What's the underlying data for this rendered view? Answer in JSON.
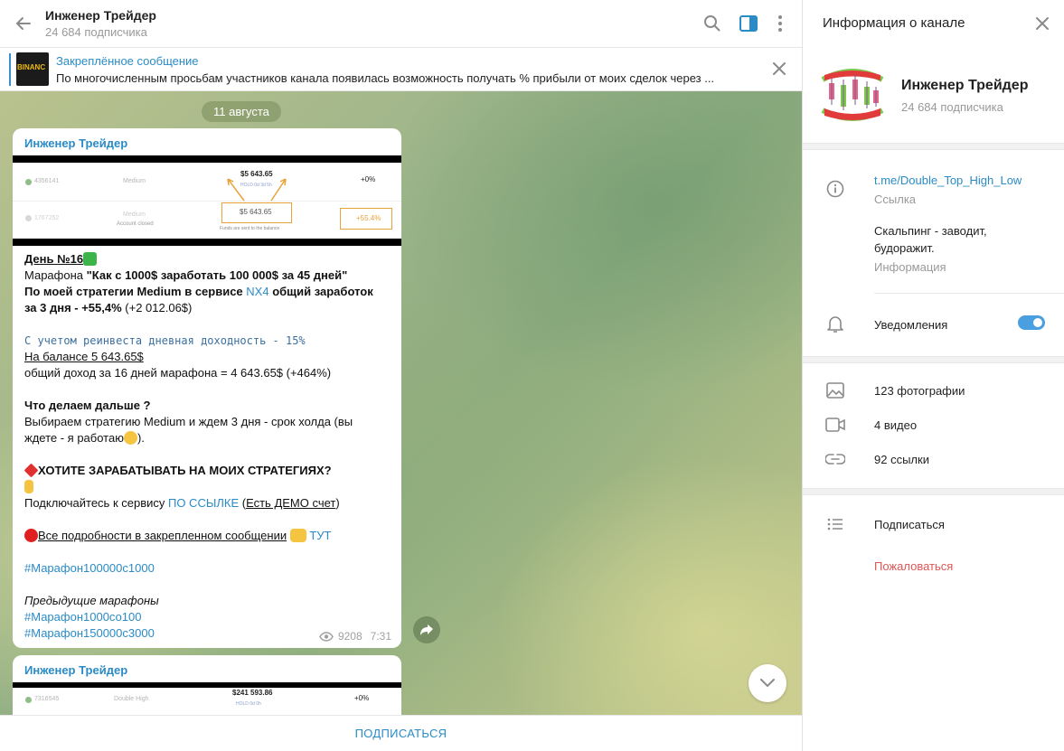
{
  "header": {
    "title": "Инженер Трейдер",
    "subscribers": "24 684 подписчика"
  },
  "pinned": {
    "title": "Закреплённое сообщение",
    "text": "По многочисленным просьбам участников канала появилась возможность получать % прибыли от моих сделок через ...",
    "thumb_label": "BINANC"
  },
  "chat": {
    "date": "11 августа",
    "message1": {
      "author": "Инженер Трейдер",
      "image": {
        "row1_id": "4356141",
        "row1_strategy": "Medium",
        "row1_amount": "$5 643.65",
        "row1_hold": "HOLD 0d 3d 5h",
        "row1_pct": "+0%",
        "row2_id": "1767252",
        "row2_strategy": "Medium",
        "row2_status": "Account closed",
        "row2_amount": "$5 643.65",
        "row2_note": "Funds are sent to the balance",
        "row2_pct": "+55.4%"
      },
      "day_label": "День №16",
      "l2_pre": "Марафона ",
      "l2_bold": "\"Как с 1000$ заработать 100 000$ за 45 дней\"",
      "l3_bold1": "По моей стратегии Medium в сервисе ",
      "l3_link": "NX4",
      "l3_bold2": " общий заработок",
      "l4_bold": "за 3 дня - +55,4%",
      "l4_rest": " (+2 012.06$)",
      "mono_line": "С учетом реинвеста дневная доходность - 15%",
      "balance_line": "На балансе 5 643.65$",
      "income_line": "общий доход за 16 дней марафона = 4 643.65$ (+464%)",
      "next_title": "Что делаем дальше ?",
      "next_l1": " Выбираем стратегию Medium и ждем 3 дня - срок холда (вы",
      "next_l2": "ждете - я работаю",
      "next_l2_end": ").",
      "cta": "ХОТИТЕ ЗАРАБАТЫВАТЬ НА МОИХ СТРАТЕГИЯХ?",
      "connect_pre": "Подключайтесь к сервису ",
      "connect_link": "ПО ССЫЛКЕ",
      "connect_mid": " (",
      "connect_demo": "Есть ДЕМО счет",
      "connect_end": ")",
      "details_text": "Все подробности в закрепленном сообщении",
      "details_link": "ТУТ",
      "hashtag1": "#Марафон100000с1000",
      "prev_title": "Предыдущие марафоны",
      "hashtag2": "#Марафон1000со100",
      "hashtag3": "#Марафон150000с3000",
      "views": "9208",
      "time": "7:31"
    },
    "message2": {
      "author": "Инженер Трейдер",
      "image": {
        "row1_id": "7316545",
        "row1_strategy": "Double High",
        "row1_amount": "$241 593.86",
        "row1_hold": "HOLD 0d 0h",
        "row1_pct": "+0%"
      }
    }
  },
  "footer": {
    "subscribe": "ПОДПИСАТЬСЯ"
  },
  "info": {
    "title": "Информация о канале",
    "name": "Инженер Трейдер",
    "subscribers": "24 684 подписчика",
    "link": "t.me/Double_Top_High_Low",
    "link_label": "Ссылка",
    "description_l1": "Скальпинг - заводит,",
    "description_l2": "будоражит.",
    "description_label": "Информация",
    "notifications": "Уведомления",
    "notifications_on": true,
    "photos": "123 фотографии",
    "videos": "4 видео",
    "links": "92 ссылки",
    "subscribe": "Подписаться",
    "report": "Пожаловаться"
  },
  "colors": {
    "accent": "#2a8bc7",
    "danger": "#e05555",
    "toggle": "#4a9fe0"
  }
}
